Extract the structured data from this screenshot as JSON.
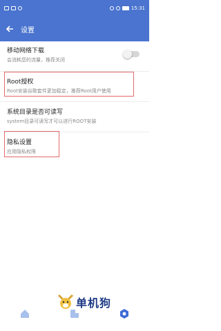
{
  "status_bar": {
    "time": "15:31"
  },
  "app_bar": {
    "title": "设置"
  },
  "settings": [
    {
      "title": "移动网络下载",
      "subtitle": "会消耗您的流量，推荐关闭",
      "toggle": false
    },
    {
      "title": "Root授权",
      "subtitle": "Root安装谷歌套件更加稳定，推荐Root用户使用"
    },
    {
      "title": "系统目录是否可读写",
      "subtitle": "system目录可读写才可以进行ROOT安装"
    },
    {
      "title": "隐私设置",
      "subtitle": "应用隐私权限"
    }
  ],
  "watermark": {
    "text": "单机狗"
  },
  "colors": {
    "primary": "#4a74cf",
    "highlight": "#e26a6a",
    "nav_active": "#3d6bd6",
    "nav_inactive": "#a8c1ec"
  },
  "icons": [
    "back-arrow-icon",
    "home-icon",
    "apps-icon",
    "settings-icon"
  ]
}
